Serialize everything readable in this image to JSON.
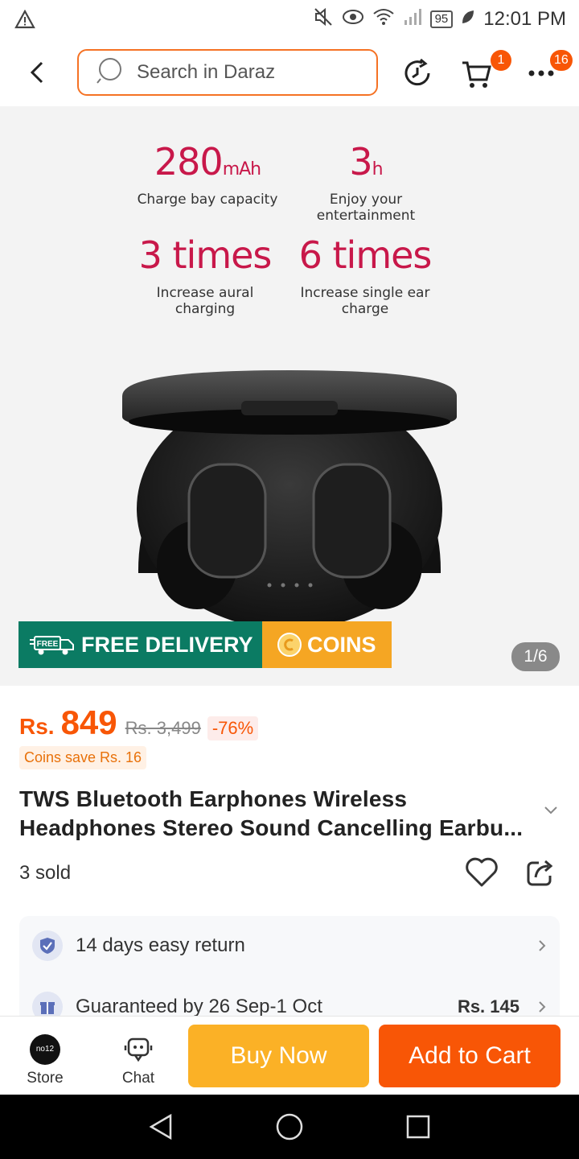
{
  "status_bar": {
    "time": "12:01 PM",
    "battery": "95"
  },
  "search": {
    "placeholder": "Search in Daraz"
  },
  "header": {
    "cart_badge": "1",
    "more_badge": "16"
  },
  "gallery": {
    "specs": [
      {
        "value": "280",
        "unit": "mAh",
        "label": "Charge bay capacity"
      },
      {
        "value": "3",
        "unit": "h",
        "label": "Enjoy your entertainment"
      },
      {
        "value": "3 times",
        "unit": "",
        "label": "Increase aural charging"
      },
      {
        "value": "6 times",
        "unit": "",
        "label": "Increase single ear charge"
      }
    ],
    "free_delivery_tag": "FREE",
    "free_delivery_label": "FREE DELIVERY",
    "coins_label": "COINS",
    "counter": "1/6"
  },
  "product": {
    "currency": "Rs.",
    "price": "849",
    "original_price": "Rs. 3,499",
    "discount": "-76%",
    "coins_save": "Coins save Rs. 16",
    "title_line1": "TWS Bluetooth Earphones Wireless",
    "title_line2": "Headphones Stereo Sound Cancelling Earbu...",
    "sold": "3 sold"
  },
  "services": [
    {
      "text": "14 days easy return",
      "price": ""
    },
    {
      "text": "Guaranteed by 26 Sep-1 Oct",
      "price": "Rs. 145"
    }
  ],
  "actions": {
    "store_logo": "no12",
    "store_label": "Store",
    "chat_label": "Chat",
    "buy_now": "Buy Now",
    "add_to_cart": "Add to Cart"
  },
  "colors": {
    "accent": "#f85606",
    "buy_now": "#fbb126",
    "free_delivery": "#0b7b63",
    "coins": "#f5a623",
    "spec_red": "#c8184a"
  }
}
